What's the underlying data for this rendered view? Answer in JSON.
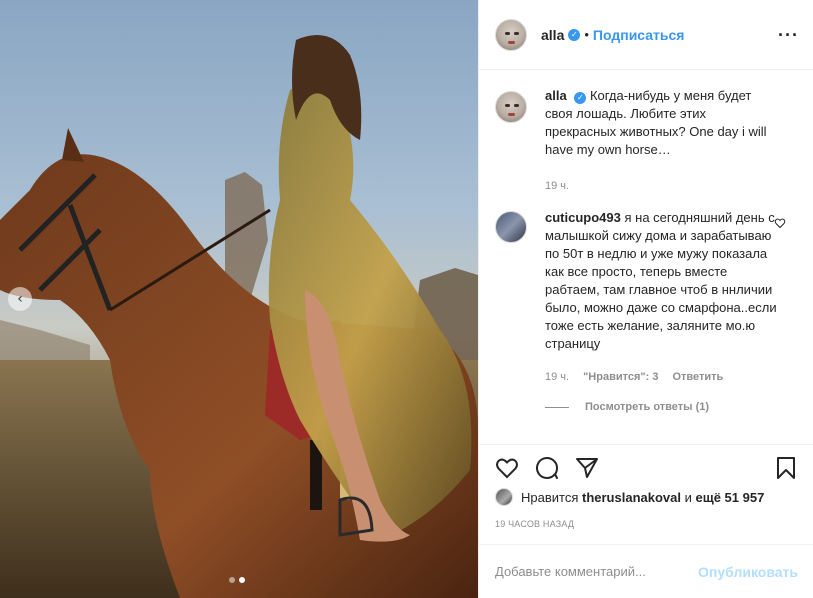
{
  "post": {
    "author": "alla",
    "separator": "•",
    "follow_label": "Подписаться",
    "more_label": "···",
    "carousel_prev_label": "‹",
    "carousel_count": 2,
    "carousel_active_index": 1
  },
  "caption": {
    "user": "alla",
    "text": "Когда-нибудь у меня будет своя лошадь. Любите этих прекрасных животных? One day i will have my own horse…",
    "time": "19 ч."
  },
  "comments": [
    {
      "user": "cuticupo493",
      "text": "я на сегодняшний день с малышкой сижу дома и зарабатываю по 50т в недлю и уже мужу показала как все просто, теперь вместе рабтаем, там главное чтоб в ннличии было, можно даже со смарфона..если тоже есть желание, заляните мо.ю страницу",
      "time": "19 ч.",
      "likes_label": "\"Нравится\": 3",
      "reply_label": "Ответить",
      "view_replies_label": "Посмотреть ответы (1)"
    }
  ],
  "likes": {
    "prefix": "Нравится",
    "user": "theruslanakoval",
    "middle": "и",
    "others": "ещё 51 957"
  },
  "timestamp": "19 часов назад",
  "add_comment": {
    "placeholder": "Добавьте комментарий...",
    "post_label": "Опубликовать"
  },
  "icons": {
    "like": "heart-icon",
    "comment": "comment-icon",
    "share": "share-icon",
    "save": "bookmark-icon",
    "verified": "verified-badge-icon",
    "comment_like": "small-heart-icon"
  },
  "colors": {
    "link_blue": "#3897f0",
    "muted_gray": "#8e8e8e",
    "post_button_disabled": "#b2dffc"
  }
}
